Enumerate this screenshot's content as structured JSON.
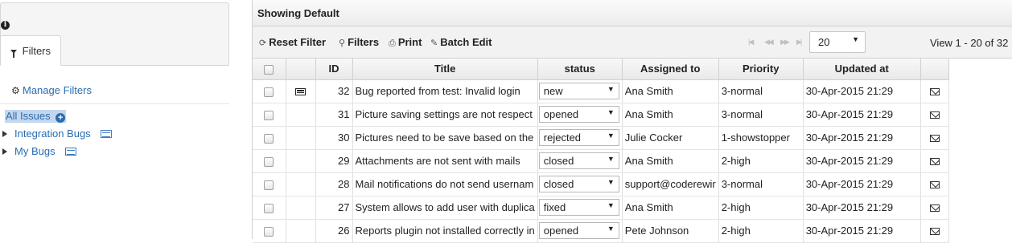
{
  "sidebar": {
    "info_glyph": "i",
    "tab_label": "Filters",
    "manage_label": "Manage Filters",
    "all_issues_label": "All Issues",
    "items": [
      {
        "label": "Integration Bugs"
      },
      {
        "label": "My Bugs"
      }
    ]
  },
  "grid": {
    "title": "Showing Default",
    "toolbar": {
      "reset": "Reset Filter",
      "filters": "Filters",
      "print": "Print",
      "batch_edit": "Batch Edit",
      "page_size": "20",
      "view_info": "View 1 - 20 of 32"
    },
    "columns": [
      "ID",
      "Title",
      "status",
      "Assigned to",
      "Priority",
      "Updated at"
    ],
    "rows": [
      {
        "id": "32",
        "title": "Bug reported from test: Invalid login",
        "status": "new",
        "assigned": "Ana Smith",
        "priority": "3-normal",
        "updated": "30-Apr-2015 21:29",
        "has_icon": true
      },
      {
        "id": "31",
        "title": "Picture saving settings are not respect",
        "status": "opened",
        "assigned": "Ana Smith",
        "priority": "3-normal",
        "updated": "30-Apr-2015 21:29",
        "has_icon": false
      },
      {
        "id": "30",
        "title": "Pictures need to be save based on the",
        "status": "rejected",
        "assigned": "Julie Cocker",
        "priority": "1-showstopper",
        "updated": "30-Apr-2015 21:29",
        "has_icon": false
      },
      {
        "id": "29",
        "title": "Attachments are not sent with mails",
        "status": "closed",
        "assigned": "Ana Smith",
        "priority": "2-high",
        "updated": "30-Apr-2015 21:29",
        "has_icon": false
      },
      {
        "id": "28",
        "title": "Mail notifications do not send usernam",
        "status": "closed",
        "assigned": "support@coderewir",
        "priority": "3-normal",
        "updated": "30-Apr-2015 21:29",
        "has_icon": false
      },
      {
        "id": "27",
        "title": "System allows to add user with duplica",
        "status": "fixed",
        "assigned": "Ana Smith",
        "priority": "2-high",
        "updated": "30-Apr-2015 21:29",
        "has_icon": false
      },
      {
        "id": "26",
        "title": "Reports plugin not installed correctly in",
        "status": "opened",
        "assigned": "Pete Johnson",
        "priority": "2-high",
        "updated": "30-Apr-2015 21:29",
        "has_icon": false
      }
    ]
  }
}
